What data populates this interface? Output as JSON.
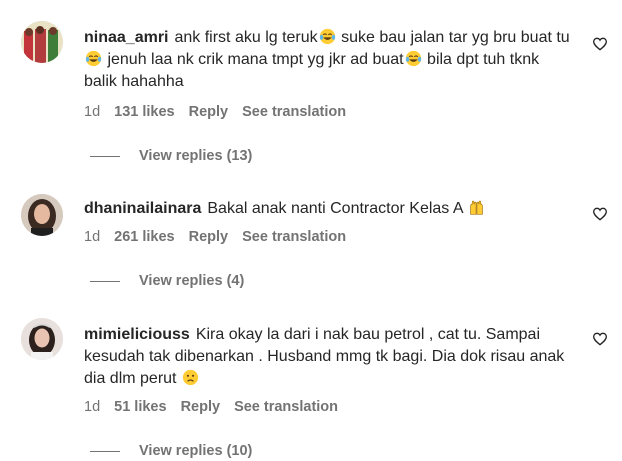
{
  "comments": [
    {
      "username": "ninaa_amri",
      "segments": [
        "ank first aku lg teruk",
        " suke bau jalan tar yg bru buat tu",
        " jenuh laa nk crik mana tmpt yg jkr ad buat",
        " bila dpt tuh tknk balik hahahha"
      ],
      "emojis": [
        "face-with-tears-of-joy",
        "face-with-tears-of-joy",
        "face-with-tears-of-joy"
      ],
      "time": "1d",
      "likes": "131 likes",
      "reply_label": "Reply",
      "translation_label": "See translation",
      "view_replies": "View replies (13)"
    },
    {
      "username": "dhaninailainara",
      "segments": [
        "Bakal anak nanti Contractor Kelas A "
      ],
      "emojis": [
        "raising-hands"
      ],
      "time": "1d",
      "likes": "261 likes",
      "reply_label": "Reply",
      "translation_label": "See translation",
      "view_replies": "View replies (4)"
    },
    {
      "username": "mimieliciouss",
      "segments": [
        "Kira okay la dari i nak bau petrol , cat tu. Sampai kesudah tak dibenarkan . Husband mmg tk bagi. Dia dok risau anak dia dlm perut "
      ],
      "emojis": [
        "sad-face"
      ],
      "time": "1d",
      "likes": "51 likes",
      "reply_label": "Reply",
      "translation_label": "See translation",
      "view_replies": "View replies (10)"
    }
  ],
  "colors": {
    "text": "#262626",
    "secondary": "#737373",
    "emoji_yellow": "#ffcc33"
  }
}
